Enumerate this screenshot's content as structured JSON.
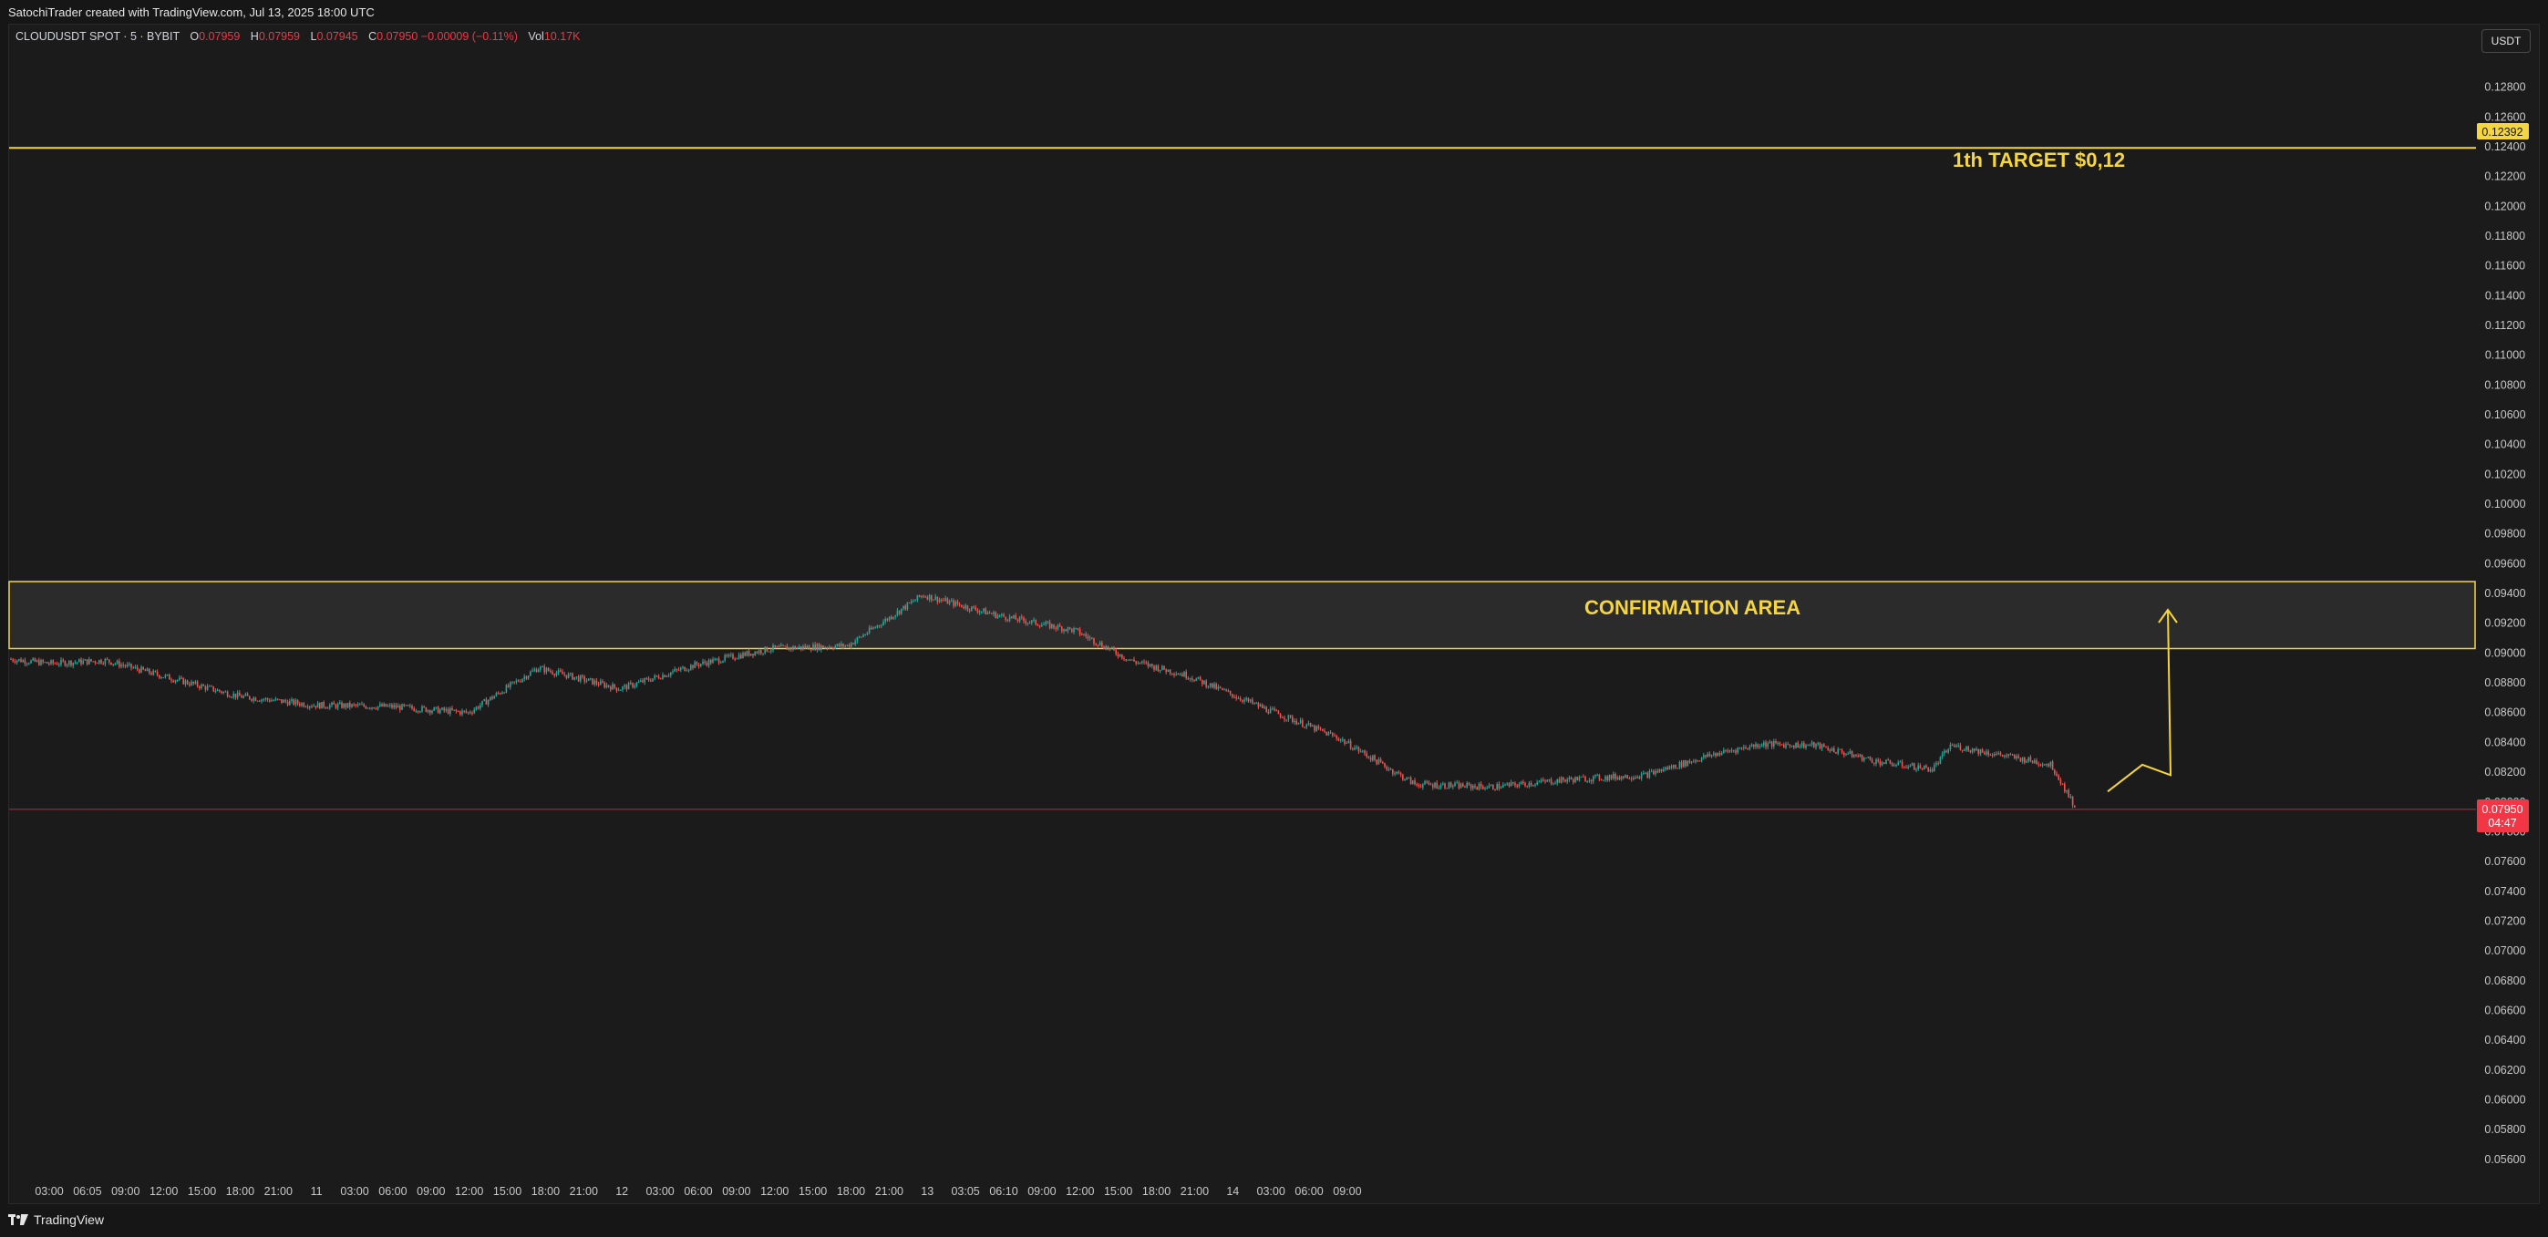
{
  "header": {
    "created_by": "SatochiTrader created with TradingView.com, Jul 13, 2025 18:00 UTC"
  },
  "legend": {
    "symbol": "CLOUDUSDT SPOT · 5 · BYBIT",
    "open_label": "O",
    "open": "0.07959",
    "high_label": "H",
    "high": "0.07959",
    "low_label": "L",
    "low": "0.07945",
    "close_label": "C",
    "close": "0.07950",
    "change": "−0.00009 (−0.11%)",
    "vol_label": "Vol",
    "vol": "10.17K"
  },
  "price_scale": {
    "currency": "USDT",
    "ticks": [
      "0.12800",
      "0.12600",
      "0.12400",
      "0.12200",
      "0.12000",
      "0.11800",
      "0.11600",
      "0.11400",
      "0.11200",
      "0.11000",
      "0.10800",
      "0.10600",
      "0.10400",
      "0.10200",
      "0.10000",
      "0.09800",
      "0.09600",
      "0.09400",
      "0.09200",
      "0.09000",
      "0.08800",
      "0.08600",
      "0.08400",
      "0.08200",
      "0.08000",
      "0.07800",
      "0.07600",
      "0.07400",
      "0.07200",
      "0.07000",
      "0.06800",
      "0.06600",
      "0.06400",
      "0.06200",
      "0.06000",
      "0.05800",
      "0.05600"
    ],
    "target_label": "0.12392",
    "last_price_label": "0.07950",
    "countdown": "04:47"
  },
  "time_axis": {
    "ticks": [
      "03:00",
      "06:05",
      "09:00",
      "12:00",
      "15:00",
      "18:00",
      "21:00",
      "11",
      "03:00",
      "06:00",
      "09:00",
      "12:00",
      "15:00",
      "18:00",
      "21:00",
      "12",
      "03:00",
      "06:00",
      "09:00",
      "12:00",
      "15:00",
      "18:00",
      "21:00",
      "13",
      "03:05",
      "06:10",
      "09:00",
      "12:00",
      "15:00",
      "18:00",
      "21:00",
      "14",
      "03:00",
      "06:00",
      "09:00"
    ]
  },
  "annotations": {
    "target_text": "1th TARGET $0,12",
    "zone_text": "CONFIRMATION AREA",
    "target_price": 0.12392,
    "zone_low": 0.0903,
    "zone_high": 0.0948,
    "current_price": 0.0795
  },
  "colors": {
    "up": "#26a69a",
    "down": "#ef5350",
    "annotation": "#f5d540",
    "price_line": "#f23645"
  },
  "chart_data": {
    "type": "line",
    "x": [
      "10 01:00",
      "10 03:00",
      "10 06:05",
      "10 09:00",
      "10 12:00",
      "10 15:00",
      "10 18:00",
      "10 21:00",
      "11 00:00",
      "11 03:00",
      "11 06:00",
      "11 09:00",
      "11 12:00",
      "11 15:00",
      "11 18:00",
      "11 21:00",
      "12 00:00",
      "12 03:00",
      "12 06:00",
      "12 09:00",
      "12 12:00",
      "12 15:00",
      "12 18:00",
      "12 21:00",
      "13 00:00",
      "13 03:05",
      "13 06:10",
      "13 09:00",
      "13 12:00",
      "13 15:00",
      "13 17:00",
      "13 18:00"
    ],
    "series": [
      {
        "values": [
          0.0896,
          0.0893,
          0.0895,
          0.0885,
          0.0871,
          0.0865,
          0.0864,
          0.086,
          0.089,
          0.0876,
          0.0892,
          0.0903,
          0.0905,
          0.0939,
          0.0925,
          0.0915,
          0.0895,
          0.0885,
          0.0863,
          0.0843,
          0.0812,
          0.081,
          0.0815,
          0.0818,
          0.0832,
          0.0839,
          0.0838,
          0.0827,
          0.0822,
          0.0838,
          0.0825,
          0.0795
        ]
      }
    ],
    "ylim": [
      0.0555,
      0.1292
    ],
    "price_scale_side": "right"
  }
}
